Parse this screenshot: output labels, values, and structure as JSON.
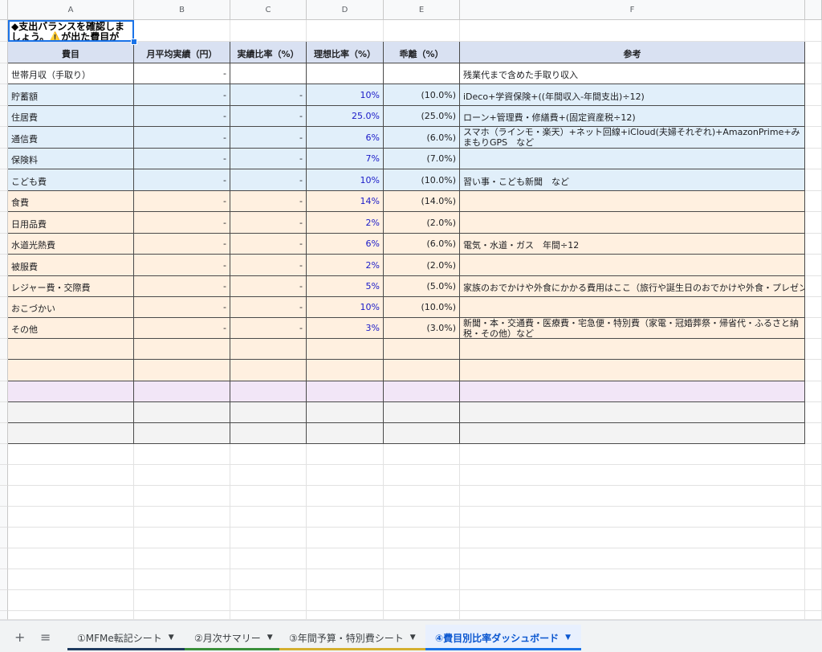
{
  "columns": [
    "A",
    "B",
    "C",
    "D",
    "E",
    "F"
  ],
  "title": "◆支出バランスを確認しましょう。⚠️が出た費目が",
  "header": {
    "a": "費目",
    "b": "月平均実績（円）",
    "c": "実績比率（%）",
    "d": "理想比率（%）",
    "e": "乖離（%）",
    "f": "参考"
  },
  "rows": [
    {
      "a": "世帯月収（手取り）",
      "b": "-",
      "c": "",
      "d": "",
      "e": "",
      "f": "残業代まで含めた手取り収入"
    },
    {
      "a": "貯蓄額",
      "b": "-",
      "c": "-",
      "d": "10%",
      "e": "(10.0%)",
      "f": "iDeco+学資保険+((年間収入-年間支出)÷12)"
    },
    {
      "a": "住居費",
      "b": "-",
      "c": "-",
      "d": "25.0%",
      "e": "(25.0%)",
      "f": "ローン+管理費・修繕費+(固定資産税÷12)"
    },
    {
      "a": "通信費",
      "b": "-",
      "c": "-",
      "d": "6%",
      "e": "(6.0%)",
      "f": "スマホ（ラインモ・楽天）+ネット回線+iCloud(夫婦それぞれ)+AmazonPrime+みまもりGPS　など"
    },
    {
      "a": "保険料",
      "b": "-",
      "c": "-",
      "d": "7%",
      "e": "(7.0%)",
      "f": ""
    },
    {
      "a": "こども費",
      "b": "-",
      "c": "-",
      "d": "10%",
      "e": "(10.0%)",
      "f": "習い事・こども新聞　など"
    },
    {
      "a": "食費",
      "b": "-",
      "c": "-",
      "d": "14%",
      "e": "(14.0%)",
      "f": ""
    },
    {
      "a": "日用品費",
      "b": "-",
      "c": "-",
      "d": "2%",
      "e": "(2.0%)",
      "f": ""
    },
    {
      "a": "水道光熱費",
      "b": "-",
      "c": "-",
      "d": "6%",
      "e": "(6.0%)",
      "f": "電気・水道・ガス　年間÷12"
    },
    {
      "a": "被服費",
      "b": "-",
      "c": "-",
      "d": "2%",
      "e": "(2.0%)",
      "f": ""
    },
    {
      "a": "レジャー費・交際費",
      "b": "-",
      "c": "-",
      "d": "5%",
      "e": "(5.0%)",
      "f": "家族のおでかけや外食にかかる費用はここ（旅行や誕生日のおでかけや外食・プレゼント代含む）"
    },
    {
      "a": "おこづかい",
      "b": "-",
      "c": "-",
      "d": "10%",
      "e": "(10.0%)",
      "f": ""
    },
    {
      "a": "その他",
      "b": "-",
      "c": "-",
      "d": "3%",
      "e": "(3.0%)",
      "f": "新聞・本・交通費・医療費・宅急便・特別費（家電・冠婚葬祭・帰省代・ふるさと納税・その他）など"
    }
  ],
  "tabs": [
    {
      "label": "①MFMe転記シート",
      "color": "#1e3a5f"
    },
    {
      "label": "②月次サマリー",
      "color": "#3a8f3a"
    },
    {
      "label": "③年間予算・特別費シート",
      "color": "#d4b030"
    },
    {
      "label": "④費目別比率ダッシュボード",
      "color": "#1a73e8"
    }
  ],
  "colors": {
    "header_bg": "#d9e1f2",
    "blue_bg": "#e1effa",
    "orange_bg": "#fff0e0",
    "purple_bg": "#f2e6f7",
    "grey_bg": "#f3f3f3",
    "value_blue": "#1a1ac8"
  }
}
